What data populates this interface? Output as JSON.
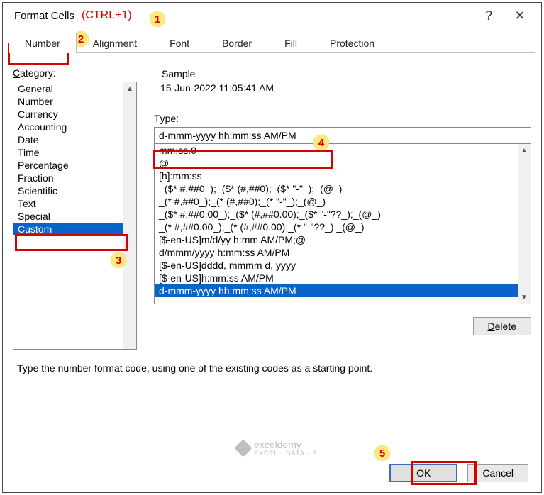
{
  "title": "Format Cells",
  "shortcut": "(CTRL+1)",
  "help_icon": "?",
  "close_icon": "✕",
  "tabs": {
    "number": "Number",
    "alignment": "Alignment",
    "font": "Font",
    "border": "Border",
    "fill": "Fill",
    "protection": "Protection"
  },
  "category_label_pre": "C",
  "category_label_rest": "ategory:",
  "categories": {
    "general": "General",
    "number": "Number",
    "currency": "Currency",
    "accounting": "Accounting",
    "date": "Date",
    "time": "Time",
    "percentage": "Percentage",
    "fraction": "Fraction",
    "scientific": "Scientific",
    "text": "Text",
    "special": "Special",
    "custom": "Custom"
  },
  "sample_label": "Sample",
  "sample_value": "15-Jun-2022 11:05:41 AM",
  "type_label_pre": "T",
  "type_label_rest": "ype:",
  "type_value": "d-mmm-yyyy hh:mm:ss AM/PM",
  "type_options": {
    "o0": "mm:ss.0",
    "o1": "@",
    "o2": "[h]:mm:ss",
    "o3": "_($* #,##0_);_($* (#,##0);_($* \"-\"_);_(@_)",
    "o4": "_(* #,##0_);_(* (#,##0);_(* \"-\"_);_(@_)",
    "o5": "_($* #,##0.00_);_($* (#,##0.00);_($* \"-\"??_);_(@_)",
    "o6": "_(* #,##0.00_);_(* (#,##0.00);_(* \"-\"??_);_(@_)",
    "o7": "[$-en-US]m/d/yy h:mm AM/PM;@",
    "o8": "d/mmm/yyyy h:mm:ss AM/PM",
    "o9": "[$-en-US]dddd, mmmm d, yyyy",
    "o10": "[$-en-US]h:mm:ss AM/PM",
    "o11": "d-mmm-yyyy hh:mm:ss AM/PM"
  },
  "delete_pre": "D",
  "delete_rest": "elete",
  "description": "Type the number format code, using one of the existing codes as a starting point.",
  "ok": "OK",
  "cancel": "Cancel",
  "annotations": {
    "a1": "1",
    "a2": "2",
    "a3": "3",
    "a4": "4",
    "a5": "5"
  },
  "watermark_main": "exceldemy",
  "watermark_sub": "EXCEL · DATA · BI"
}
